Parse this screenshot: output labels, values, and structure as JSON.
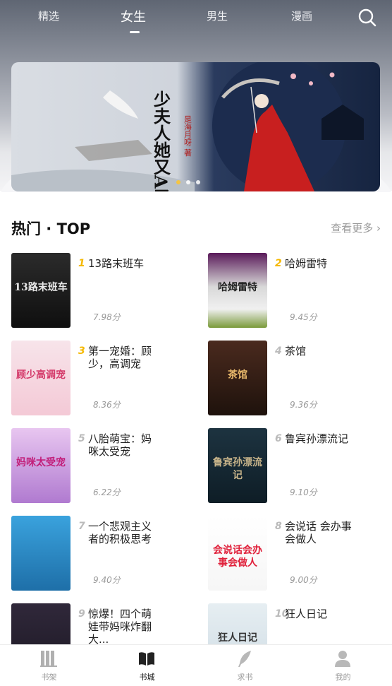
{
  "tabs": [
    {
      "label": "精选",
      "active": false
    },
    {
      "label": "女生",
      "active": true
    },
    {
      "label": "男生",
      "active": false
    },
    {
      "label": "漫画",
      "active": false
    }
  ],
  "banner": {
    "title_text": "少夫人她又A又妖",
    "author_text": "是海月呀 著",
    "dots": 3,
    "active_dot": 0
  },
  "section": {
    "title": "热门 · TOP",
    "more": "查看更多 ›"
  },
  "books": [
    {
      "rank": "1",
      "title": "13路末班车",
      "score": "7.98分"
    },
    {
      "rank": "2",
      "title": "哈姆雷特",
      "score": "9.45分"
    },
    {
      "rank": "3",
      "title": "第一宠婚：顾少，高调宠",
      "score": "8.36分"
    },
    {
      "rank": "4",
      "title": "茶馆",
      "score": "9.36分"
    },
    {
      "rank": "5",
      "title": "八胎萌宝：妈咪太受宠",
      "score": "6.22分"
    },
    {
      "rank": "6",
      "title": "鲁宾孙漂流记",
      "score": "9.10分"
    },
    {
      "rank": "7",
      "title": "一个悲观主义者的积极思考",
      "score": "9.40分"
    },
    {
      "rank": "8",
      "title": "会说话 会办事 会做人",
      "score": "9.00分"
    },
    {
      "rank": "9",
      "title": "惊爆！四个萌娃带妈咪炸翻大...",
      "score": ""
    },
    {
      "rank": "10",
      "title": "狂人日记",
      "score": ""
    }
  ],
  "covers": [
    {
      "text": "13路末班车"
    },
    {
      "text": "哈姆雷特"
    },
    {
      "text": "顾少高调宠"
    },
    {
      "text": "茶馆"
    },
    {
      "text": "妈咪太受宠"
    },
    {
      "text": "鲁宾孙漂流记"
    },
    {
      "text": ""
    },
    {
      "text": "会说话会办事会做人"
    },
    {
      "text": ""
    },
    {
      "text": "狂人日记"
    }
  ],
  "nav": [
    {
      "label": "书架",
      "icon": "bookshelf-icon",
      "active": false
    },
    {
      "label": "书城",
      "icon": "open-book-icon",
      "active": true
    },
    {
      "label": "求书",
      "icon": "feather-icon",
      "active": false
    },
    {
      "label": "我的",
      "icon": "user-icon",
      "active": false
    }
  ],
  "colors": {
    "rank_top3": "#f5b800",
    "rank_other": "#bbbbbb",
    "active_dot": "#f5c542"
  }
}
